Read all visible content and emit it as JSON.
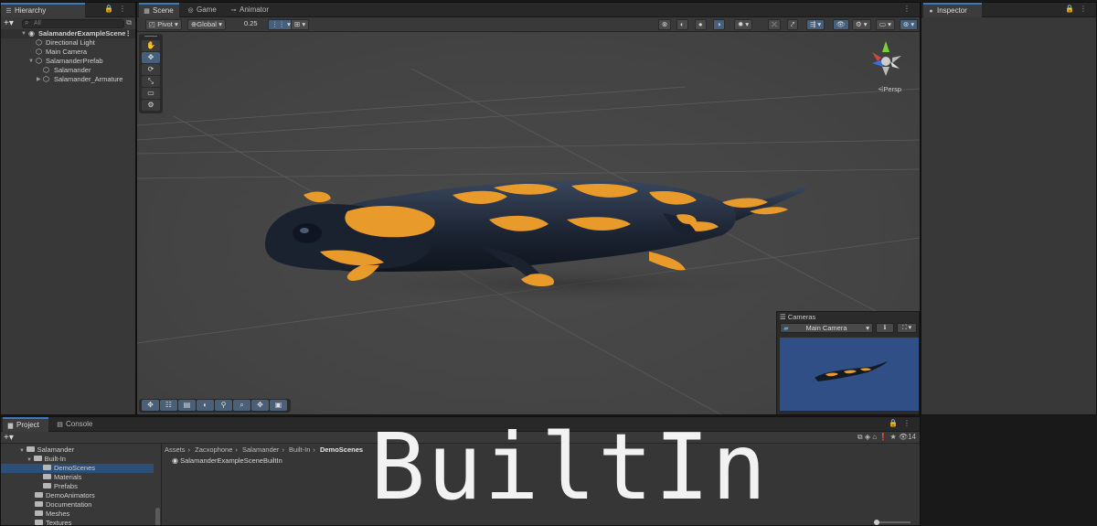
{
  "hierarchy": {
    "tab": "Hierarchy",
    "search_placeholder": "All",
    "scene": "SalamanderExampleScene",
    "items": [
      "Directional Light",
      "Main Camera",
      "SalamanderPrefab",
      "Salamander",
      "Salamander_Armature"
    ]
  },
  "scene_tabs": [
    "Scene",
    "Game",
    "Animator"
  ],
  "scene_toolbar": {
    "pivot": "Pivot",
    "global": "Global",
    "snap_value": "0.25",
    "persp": "Persp"
  },
  "cameras": {
    "title": "Cameras",
    "selected": "Main Camera"
  },
  "inspector": {
    "tab": "Inspector"
  },
  "project": {
    "tabs": [
      "Project",
      "Console"
    ],
    "tree": [
      "Salamander",
      "Built-In",
      "DemoScenes",
      "Materials",
      "Prefabs",
      "DemoAnimators",
      "Documentation",
      "Meshes",
      "Textures"
    ],
    "breadcrumb": [
      "Assets",
      "Zacxophone",
      "Salamander",
      "Built-In",
      "DemoScenes"
    ],
    "files": [
      "SalamanderExampleSceneBuiltIn"
    ],
    "hidden_count": "14"
  },
  "caption": "BuiltIn",
  "colors": {
    "accent": "#3a79bb",
    "selection": "#2c4f78",
    "camera_bg": "#2f4f86",
    "salamander_body": "#1e2634",
    "salamander_spots": "#e89a2a"
  }
}
